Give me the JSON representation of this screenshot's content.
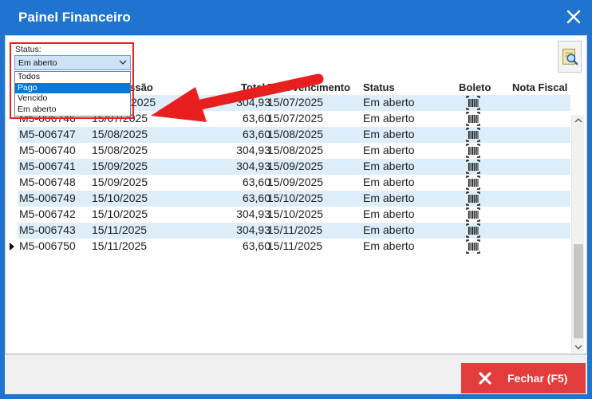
{
  "window": {
    "title": "Painel Financeiro"
  },
  "status_filter": {
    "label": "Status:",
    "selected": "Em aberto",
    "options": [
      "Todos",
      "Pago",
      "Vencido",
      "Em aberto"
    ],
    "highlighted_index": 1
  },
  "grid": {
    "headers": {
      "emissao_partial": "missão",
      "total": "Total",
      "vencimento": "Data vencimento",
      "status": "Status",
      "boleto": "Boleto",
      "nota_fiscal": "Nota Fiscal"
    },
    "rows": [
      {
        "doc": "",
        "emissao": "2025",
        "total": "304,93",
        "vencimento": "15/07/2025",
        "status": "Em aberto"
      },
      {
        "doc": "M5-006746",
        "emissao": "15/07/2025",
        "total": "63,60",
        "vencimento": "15/07/2025",
        "status": "Em aberto"
      },
      {
        "doc": "M5-006747",
        "emissao": "15/08/2025",
        "total": "63,60",
        "vencimento": "15/08/2025",
        "status": "Em aberto"
      },
      {
        "doc": "M5-006740",
        "emissao": "15/08/2025",
        "total": "304,93",
        "vencimento": "15/08/2025",
        "status": "Em aberto"
      },
      {
        "doc": "M5-006741",
        "emissao": "15/09/2025",
        "total": "304,93",
        "vencimento": "15/09/2025",
        "status": "Em aberto"
      },
      {
        "doc": "M5-006748",
        "emissao": "15/09/2025",
        "total": "63,60",
        "vencimento": "15/09/2025",
        "status": "Em aberto"
      },
      {
        "doc": "M5-006749",
        "emissao": "15/10/2025",
        "total": "63,60",
        "vencimento": "15/10/2025",
        "status": "Em aberto"
      },
      {
        "doc": "M5-006742",
        "emissao": "15/10/2025",
        "total": "304,93",
        "vencimento": "15/10/2025",
        "status": "Em aberto"
      },
      {
        "doc": "M5-006743",
        "emissao": "15/11/2025",
        "total": "304,93",
        "vencimento": "15/11/2025",
        "status": "Em aberto"
      },
      {
        "doc": "M5-006750",
        "emissao": "15/11/2025",
        "total": "63,60",
        "vencimento": "15/11/2025",
        "status": "Em aberto"
      }
    ],
    "current_row_index": 9
  },
  "footer": {
    "close_label": "Fechar (F5)"
  },
  "icons": {
    "close": "close-icon",
    "search": "search-document-icon",
    "barcode": "barcode-icon"
  },
  "colors": {
    "titlebar": "#1e74cf",
    "row_alt": "#ddeefa",
    "highlight": "#e81f1f",
    "close_button": "#e23c3c",
    "option_selected": "#0a78d7"
  }
}
